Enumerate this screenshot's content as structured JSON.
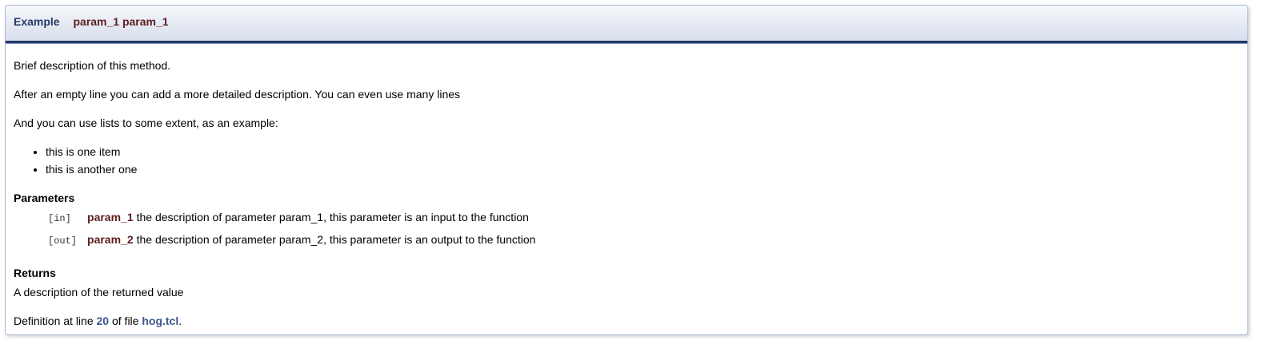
{
  "header": {
    "method_name": "Example",
    "param_names": [
      "param_1",
      "param_1"
    ]
  },
  "description": {
    "brief": "Brief description of this method.",
    "detailed": "After an empty line you can add a more detailed description. You can even use many lines",
    "list_intro": "And you can use lists to some extent, as an example:",
    "list_items": [
      "this is one item",
      "this is another one"
    ]
  },
  "parameters": {
    "title": "Parameters",
    "items": [
      {
        "direction": "[in]",
        "name": "param_1",
        "description": "the description of parameter param_1, this parameter is an input to the function"
      },
      {
        "direction": "[out]",
        "name": "param_2",
        "description": "the description of parameter param_2, this parameter is an output to the function"
      }
    ]
  },
  "returns": {
    "title": "Returns",
    "text": "A description of the returned value"
  },
  "definition": {
    "prefix": "Definition at line",
    "line": "20",
    "middle": "of file",
    "file": "hog.tcl",
    "suffix": "."
  },
  "colors": {
    "header_text": "#253a66",
    "param_name": "#602020",
    "link": "#3d578c",
    "border": "#a8b8d9"
  }
}
